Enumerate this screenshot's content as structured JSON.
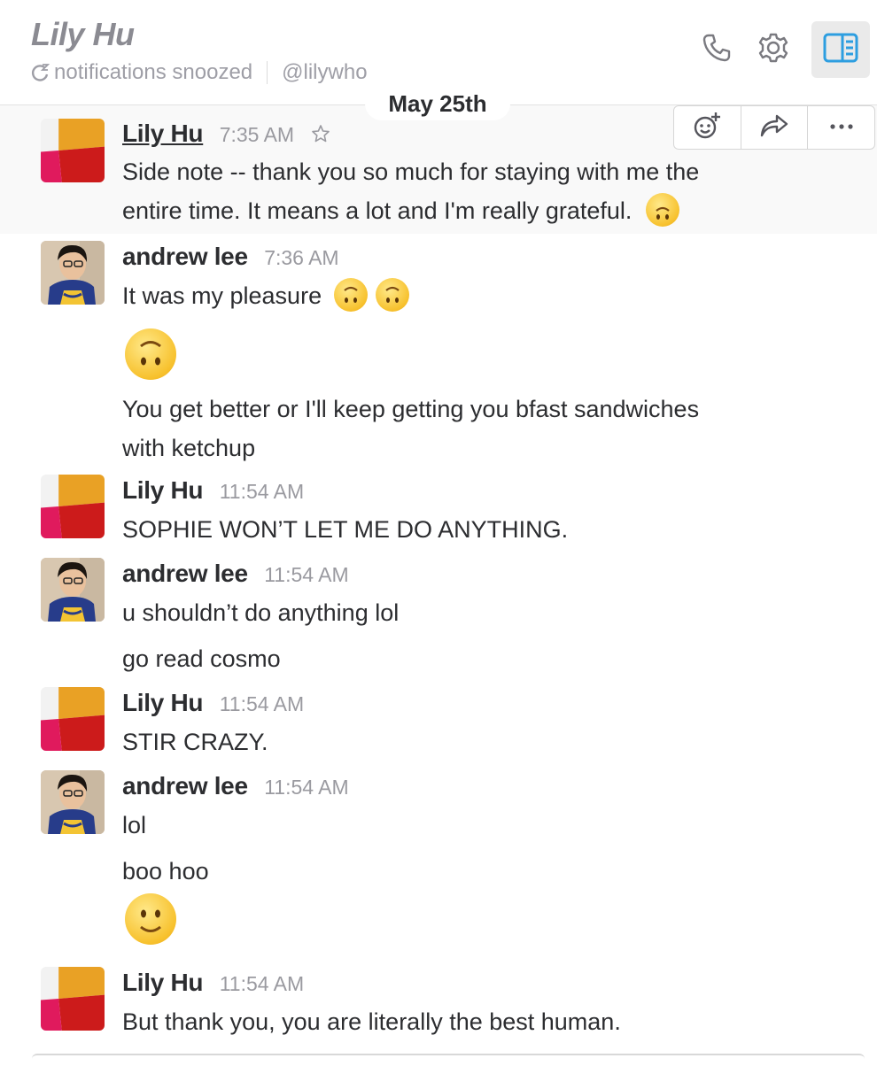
{
  "header": {
    "title": "Lily Hu",
    "status": "notifications snoozed",
    "handle": "@lilywho",
    "icons": {
      "call": "phone-icon",
      "settings": "gear-icon",
      "details": "sidebar-panel-icon"
    },
    "accent_color": "#2d9ee0"
  },
  "date_divider": "May 25th",
  "messages": [
    {
      "author": "Lily Hu",
      "time": "7:35 AM",
      "lines": [
        "Side note -- thank you so much for staying with me the",
        "entire time. It means a lot and I'm really grateful."
      ]
    },
    {
      "author": "andrew lee",
      "time": "7:36 AM",
      "lines": [
        "It was my pleasure",
        "You get better or I'll keep getting you bfast sandwiches",
        "with ketchup"
      ]
    },
    {
      "author": "Lily Hu",
      "time": "11:54 AM",
      "lines": [
        "SOPHIE WON’T LET ME DO ANYTHING."
      ]
    },
    {
      "author": "andrew lee",
      "time": "11:54 AM",
      "lines": [
        "u shouldn’t do anything lol",
        "go read cosmo"
      ]
    },
    {
      "author": "Lily Hu",
      "time": "11:54 AM",
      "lines": [
        "STIR CRAZY."
      ]
    },
    {
      "author": "andrew lee",
      "time": "11:54 AM",
      "lines": [
        "lol",
        "boo hoo"
      ]
    },
    {
      "author": "Lily Hu",
      "time": "11:54 AM",
      "lines": [
        "But thank you, you are literally the best human."
      ]
    }
  ],
  "message_actions": [
    "add-reaction-icon",
    "share-icon",
    "more-icon"
  ],
  "emoji": {
    "upside_down": "upside-down-face-icon",
    "smile": "slightly-smiling-face-icon"
  }
}
